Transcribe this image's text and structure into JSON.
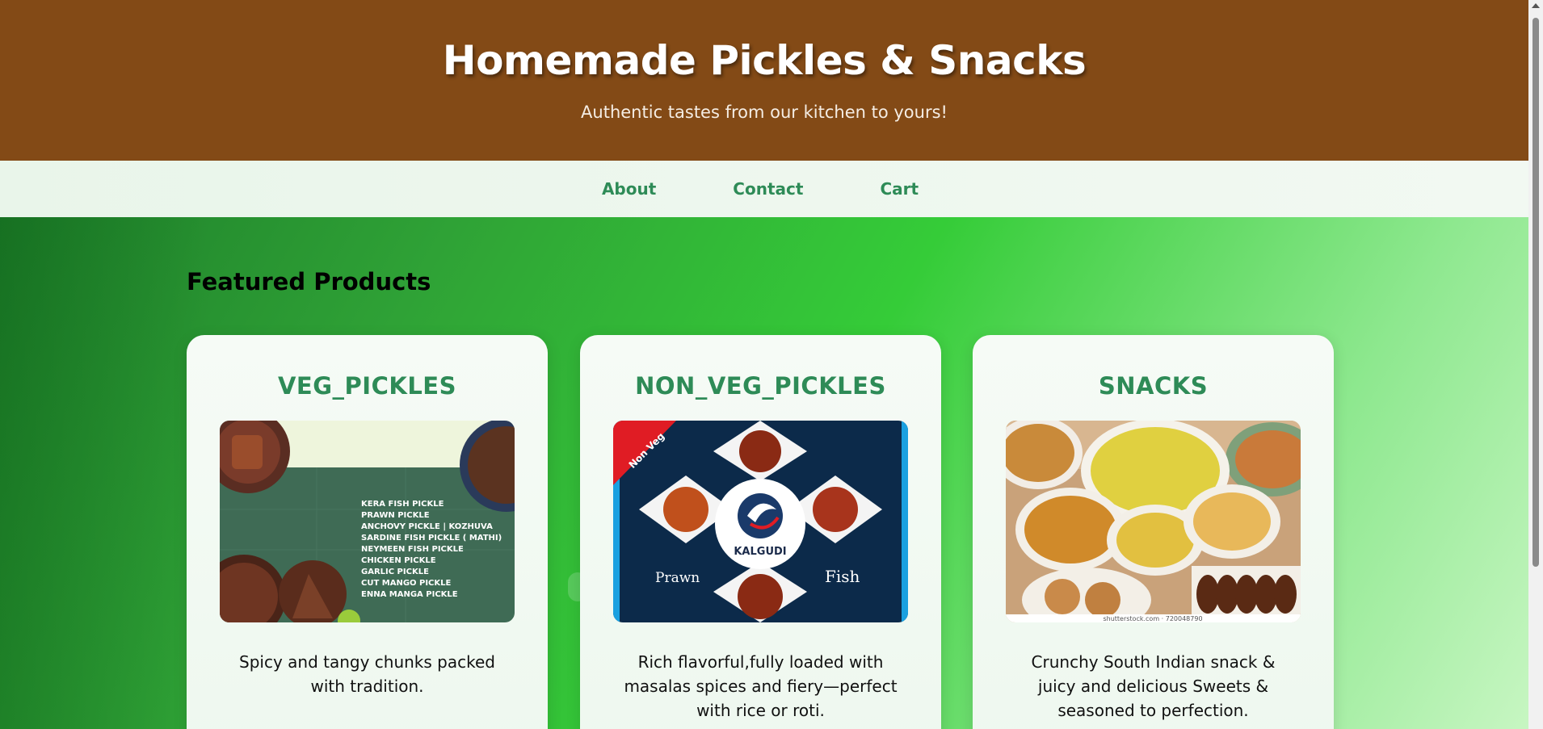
{
  "header": {
    "title": "Homemade Pickles & Snacks",
    "tagline": "Authentic tastes from our kitchen to yours!"
  },
  "nav": {
    "items": [
      {
        "label": "About"
      },
      {
        "label": "Contact"
      },
      {
        "label": "Cart"
      }
    ]
  },
  "main": {
    "section_title": "Featured Products",
    "products": [
      {
        "title": "VEG_PICKLES",
        "description": "Spicy and tangy chunks packed with tradition.",
        "image_text": {
          "list": [
            "KERA FISH PICKLE",
            "PRAWN PICKLE",
            "ANCHOVY PICKLE | KOZHUVA",
            "SARDINE FISH PICKLE ( MATHI)",
            "NEYMEEN FISH PICKLE",
            "CHICKEN PICKLE",
            "GARLIC PICKLE",
            "CUT MANGO PICKLE",
            "ENNA MANGA PICKLE"
          ]
        }
      },
      {
        "title": "NON_VEG_PICKLES",
        "description": "Rich flavorful,fully loaded with masalas spices and fiery—perfect with rice or roti.",
        "image_text": {
          "ribbon": "Non Veg",
          "brand": "KALGUDI",
          "left": "Prawn",
          "right": "Fish"
        }
      },
      {
        "title": "SNACKS",
        "description": "Crunchy South Indian snack & juicy and delicious Sweets & seasoned to perfection.",
        "image_text": {
          "watermark": "shutterstock.com · 720048790"
        }
      }
    ]
  },
  "colors": {
    "header_bg": "#834a16",
    "nav_link": "#2e8b57",
    "card_title": "#2e8b57",
    "main_bg_mid": "#35cc38"
  }
}
